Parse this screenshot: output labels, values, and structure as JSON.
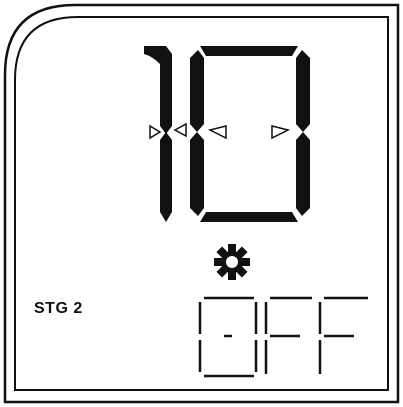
{
  "display": {
    "main_value": "10",
    "secondary_value": "OFF",
    "stage_label": "STG 2",
    "settings_icon": "gear-icon",
    "colors": {
      "background": "#ffffff",
      "segment": "#111111",
      "frame": "#111111"
    }
  }
}
